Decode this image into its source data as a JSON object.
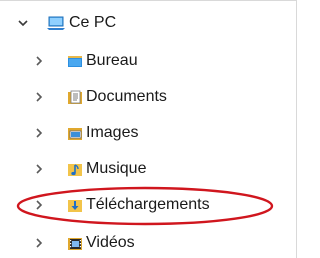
{
  "tree": {
    "root": {
      "label": "Ce PC",
      "icon": "computer-icon",
      "expanded": true
    },
    "items": [
      {
        "label": "Bureau",
        "icon": "desktop-folder-icon",
        "expanded": false
      },
      {
        "label": "Documents",
        "icon": "documents-folder-icon",
        "expanded": false
      },
      {
        "label": "Images",
        "icon": "pictures-folder-icon",
        "expanded": false
      },
      {
        "label": "Musique",
        "icon": "music-folder-icon",
        "expanded": false
      },
      {
        "label": "Téléchargements",
        "icon": "downloads-folder-icon",
        "expanded": false,
        "highlighted": true
      },
      {
        "label": "Vidéos",
        "icon": "videos-folder-icon",
        "expanded": false
      }
    ]
  },
  "colors": {
    "chevron": "#5a5a5a",
    "folder_yellow": "#f8d775",
    "folder_dark": "#e0a82e",
    "highlight_ellipse": "#d0161e",
    "monitor_blue": "#1e88e5"
  }
}
